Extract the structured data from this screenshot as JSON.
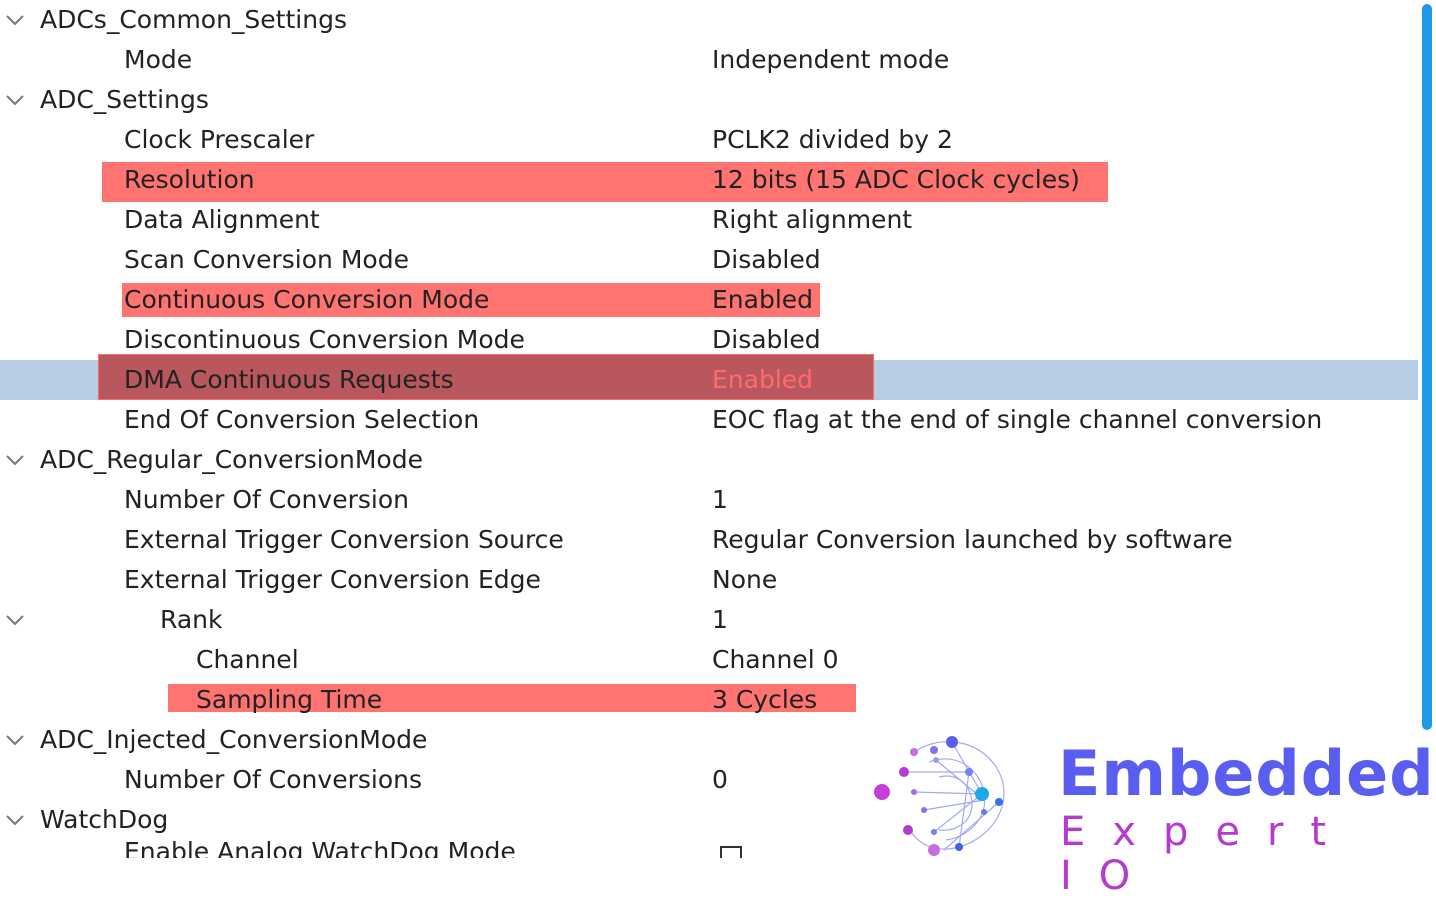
{
  "rows": [
    {
      "label": "ADCs_Common_Settings",
      "value": "",
      "group": true
    },
    {
      "label": "Mode",
      "value": "Independent mode"
    },
    {
      "label": "ADC_Settings",
      "value": "",
      "group": true
    },
    {
      "label": "Clock Prescaler",
      "value": "PCLK2 divided by 2"
    },
    {
      "label": "Resolution",
      "value": "12 bits (15 ADC Clock cycles)"
    },
    {
      "label": "Data Alignment",
      "value": "Right alignment"
    },
    {
      "label": "Scan Conversion Mode",
      "value": "Disabled"
    },
    {
      "label": "Continuous Conversion Mode",
      "value": "Enabled"
    },
    {
      "label": "Discontinuous Conversion Mode",
      "value": "Disabled"
    },
    {
      "label": "DMA Continuous Requests",
      "value": "Enabled",
      "selected": true
    },
    {
      "label": "End Of Conversion Selection",
      "value": "EOC flag at the end of single channel conversion"
    },
    {
      "label": "ADC_Regular_ConversionMode",
      "value": "",
      "group": true
    },
    {
      "label": "Number Of Conversion",
      "value": "1"
    },
    {
      "label": "External Trigger Conversion Source",
      "value": "Regular Conversion launched by software"
    },
    {
      "label": "External Trigger Conversion Edge",
      "value": "None"
    },
    {
      "label": "Rank",
      "value": "1",
      "group": true
    },
    {
      "label": "Channel",
      "value": "Channel 0"
    },
    {
      "label": "Sampling Time",
      "value": "3 Cycles"
    },
    {
      "label": "ADC_Injected_ConversionMode",
      "value": "",
      "group": true
    },
    {
      "label": "Number Of Conversions",
      "value": "0"
    },
    {
      "label": "WatchDog",
      "value": "",
      "group": true
    },
    {
      "label": "Enable Analog WatchDog Mode",
      "value": "",
      "checkbox": true,
      "checked": false
    }
  ],
  "logo": {
    "word": "Embedded",
    "sub": "Expert IO"
  },
  "colors": {
    "highlight": "#ff7470",
    "selected_row": "#b8cce4",
    "scroll_thumb": "#1f9ae6",
    "logo_primary": "#5a5ef0",
    "logo_secondary": "#b43ad0"
  }
}
